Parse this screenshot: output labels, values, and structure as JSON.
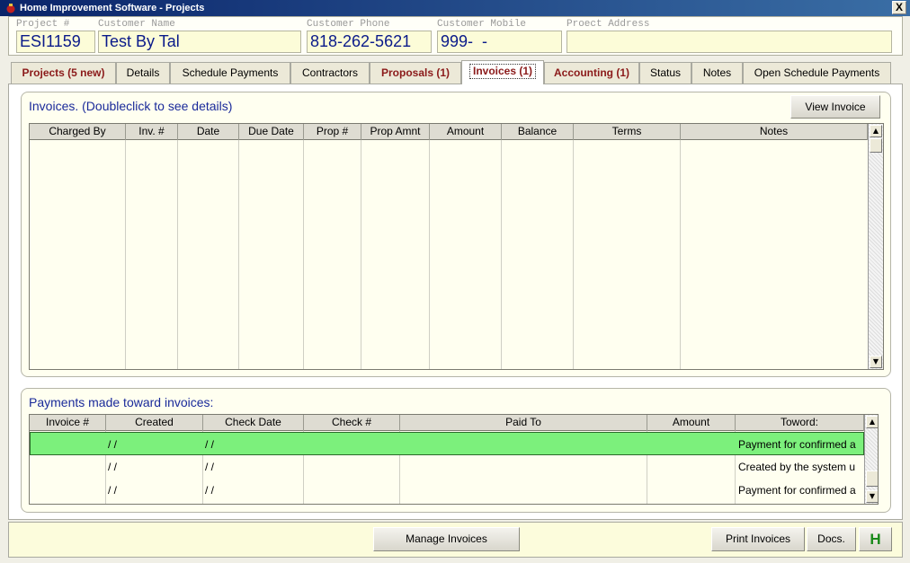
{
  "window": {
    "title": "Home Improvement Software - Projects",
    "close_label": "X"
  },
  "header": {
    "project_label": "Project #",
    "project_value": "ESI1159",
    "customer_label": "Customer Name",
    "customer_value": "Test By Tal",
    "phone_label": "Customer Phone",
    "phone_value": "818-262-5621",
    "mobile_label": "Customer Mobile",
    "mobile_value": "999-  -",
    "address_label": "Proect Address",
    "address_value": ""
  },
  "tabs": [
    {
      "label": "Projects (5 new)"
    },
    {
      "label": "Details"
    },
    {
      "label": "Schedule Payments"
    },
    {
      "label": "Contractors"
    },
    {
      "label": "Proposals (1)"
    },
    {
      "label": "Invoices (1)"
    },
    {
      "label": "Accounting (1)"
    },
    {
      "label": "Status"
    },
    {
      "label": "Notes"
    },
    {
      "label": "Open Schedule Payments"
    }
  ],
  "invoices": {
    "title": "Invoices.  (Doubleclick to see details)",
    "view_button": "View Invoice",
    "columns": [
      "Charged By",
      "Inv. #",
      "Date",
      "Due Date",
      "Prop #",
      "Prop Amnt",
      "Amount",
      "Balance",
      "Terms",
      "Notes"
    ]
  },
  "payments": {
    "title": "Payments made toward invoices:",
    "columns": [
      "Invoice #",
      "Created",
      "Check Date",
      "Check #",
      "Paid To",
      "Amount",
      "Toword:"
    ],
    "rows": [
      {
        "invoice": "",
        "created": "/ /",
        "check_date": "/ /",
        "check": "",
        "paid_to": "",
        "amount": "",
        "toward": "Payment for confirmed a"
      },
      {
        "invoice": "",
        "created": "/ /",
        "check_date": "/ /",
        "check": "",
        "paid_to": "",
        "amount": "",
        "toward": "Created by the system  u"
      },
      {
        "invoice": "",
        "created": "/ /",
        "check_date": "/ /",
        "check": "",
        "paid_to": "",
        "amount": "",
        "toward": "Payment for confirmed a"
      }
    ]
  },
  "footer": {
    "manage_button": "Manage Invoices",
    "print_button": "Print Invoices",
    "docs_button": "Docs.",
    "h_button": "H"
  }
}
